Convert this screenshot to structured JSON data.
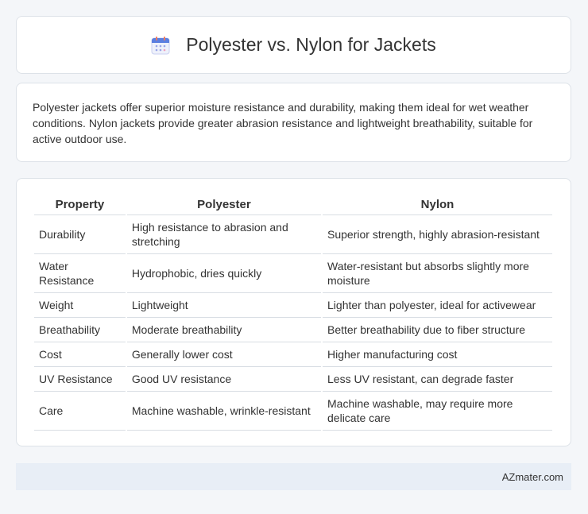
{
  "header": {
    "title": "Polyester vs. Nylon for Jackets",
    "icon": "calendar-icon"
  },
  "intro": {
    "text": "Polyester jackets offer superior moisture resistance and durability, making them ideal for wet weather conditions. Nylon jackets provide greater abrasion resistance and lightweight breathability, suitable for active outdoor use."
  },
  "table": {
    "headers": [
      "Property",
      "Polyester",
      "Nylon"
    ],
    "rows": [
      [
        "Durability",
        "High resistance to abrasion and stretching",
        "Superior strength, highly abrasion-resistant"
      ],
      [
        "Water Resistance",
        "Hydrophobic, dries quickly",
        "Water-resistant but absorbs slightly more moisture"
      ],
      [
        "Weight",
        "Lightweight",
        "Lighter than polyester, ideal for activewear"
      ],
      [
        "Breathability",
        "Moderate breathability",
        "Better breathability due to fiber structure"
      ],
      [
        "Cost",
        "Generally lower cost",
        "Higher manufacturing cost"
      ],
      [
        "UV Resistance",
        "Good UV resistance",
        "Less UV resistant, can degrade faster"
      ],
      [
        "Care",
        "Machine washable, wrinkle-resistant",
        "Machine washable, may require more delicate care"
      ]
    ]
  },
  "footer": {
    "site": "AZmater.com"
  }
}
